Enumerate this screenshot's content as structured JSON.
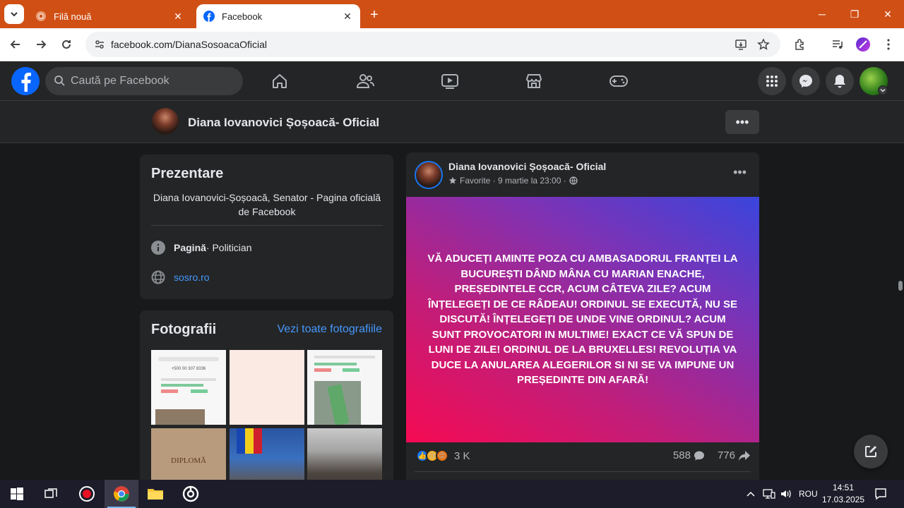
{
  "browser": {
    "tabs": [
      {
        "title": "Filă nouă",
        "active": false
      },
      {
        "title": "Facebook",
        "active": true
      }
    ],
    "url": "facebook.com/DianaSosoacaOficial"
  },
  "facebook": {
    "search_placeholder": "Caută pe Facebook",
    "page_name": "Diana Iovanovici Șoșoacă- Oficial",
    "intro": {
      "title": "Prezentare",
      "description": "Diana Iovanovici-Șoșoacă, Senator - Pagina oficială de Facebook",
      "category_label": "Pagină",
      "category_value": " · Politician",
      "website": "sosro.ro"
    },
    "photos": {
      "title": "Fotografii",
      "see_all": "Vezi toate fotografiile"
    },
    "post": {
      "author": "Diana Iovanovici Șoșoacă- Oficial",
      "meta": "Favorite · 9 martie la 23:00 ·",
      "text": "VĂ ADUCEȚI AMINTE POZA CU AMBASADORUL FRANȚEI LA BUCUREȘTI DÂND MÂNA CU MARIAN ENACHE, PREȘEDINTELE CCR, ACUM CÂTEVA ZILE? ACUM ÎNȚELEGEȚI DE CE RÂDEAU! ORDINUL SE EXECUTĂ, NU SE DISCUTĂ! ÎNȚELEGEȚI DE UNDE VINE ORDINUL? ACUM SUNT PROVOCATORI IN MULTIME! EXACT CE VĂ SPUN DE LUNI DE ZILE! ORDINUL DE LA BRUXELLES! REVOLUȚIA VA DUCE LA ANULAREA ALEGERILOR SI NI SE VA IMPUNE UN PREȘEDINTE DIN AFARĂ!",
      "reactions_count": "3 K",
      "comments_count": "588",
      "shares_count": "776"
    },
    "photo_thumbs": {
      "t1_text": "+500 00 307 8336",
      "t4_text": "DIPLOMĂ"
    }
  },
  "taskbar": {
    "language": "ROU",
    "time": "14:51",
    "date": "17.03.2025"
  },
  "colors": {
    "tabstrip": "#d04f15",
    "fb_blue": "#0866ff",
    "fb_dark": "#242526",
    "link": "#4599ff"
  }
}
